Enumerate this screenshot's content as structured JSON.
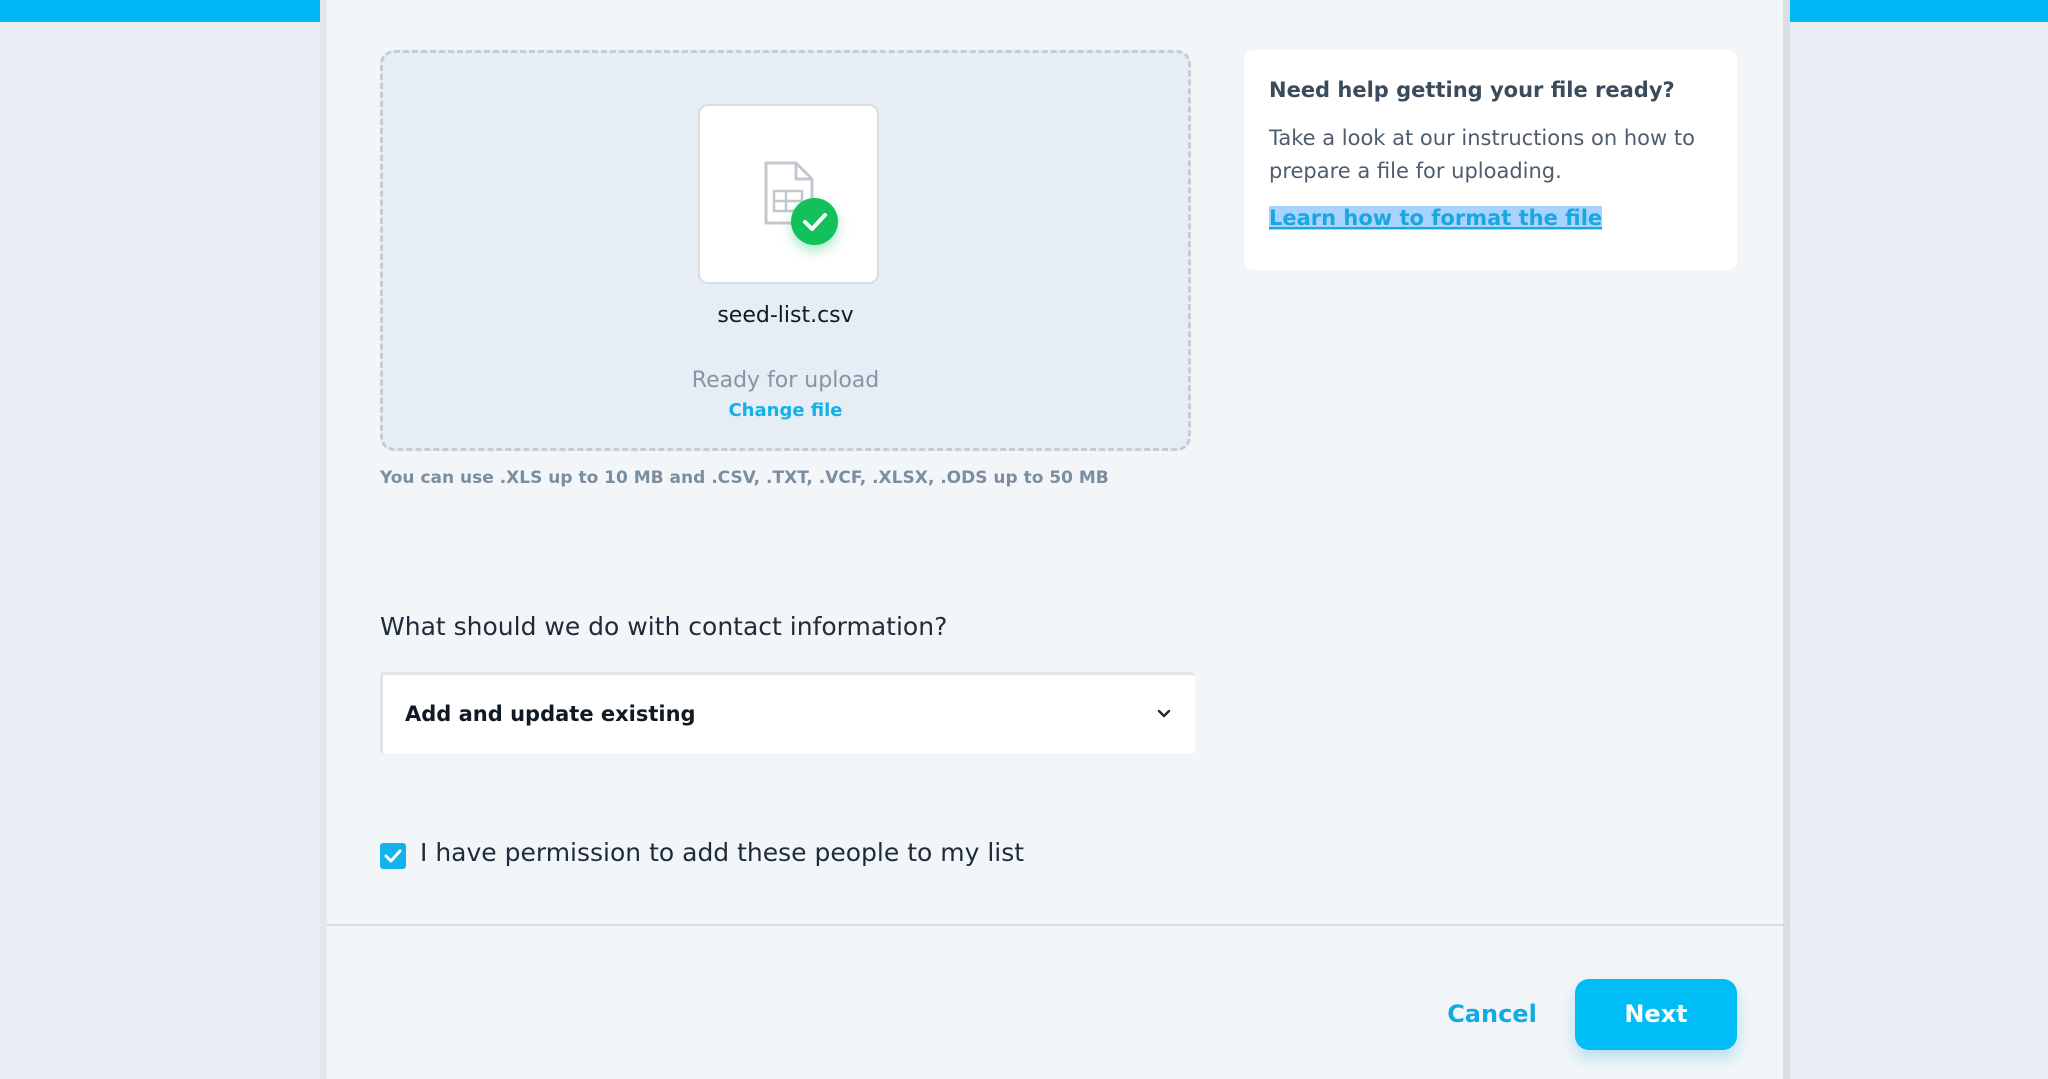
{
  "upload": {
    "file_name": "seed-list.csv",
    "status": "Ready for upload",
    "change_file_label": "Change file",
    "hint": "You can use .XLS up to 10 MB and .CSV, .TXT, .VCF, .XLSX, .ODS up to 50 MB"
  },
  "help": {
    "title": "Need help getting your file ready?",
    "text": "Take a look at our instructions on how to prepare a file for uploading.",
    "link_label": "Learn how to format the file"
  },
  "contact_info": {
    "question": "What should we do with contact information?",
    "selected_option": "Add and update existing"
  },
  "permission": {
    "checked": true,
    "label": "I have permission to add these people to my list"
  },
  "footer": {
    "cancel_label": "Cancel",
    "next_label": "Next"
  },
  "colors": {
    "accent": "#00bdf6",
    "success": "#12c15b",
    "link": "#13a9e4"
  },
  "icons": {
    "file": "spreadsheet-file-icon",
    "status": "check-circle-icon",
    "select": "chevron-down-icon",
    "checkbox": "checkmark-icon"
  }
}
